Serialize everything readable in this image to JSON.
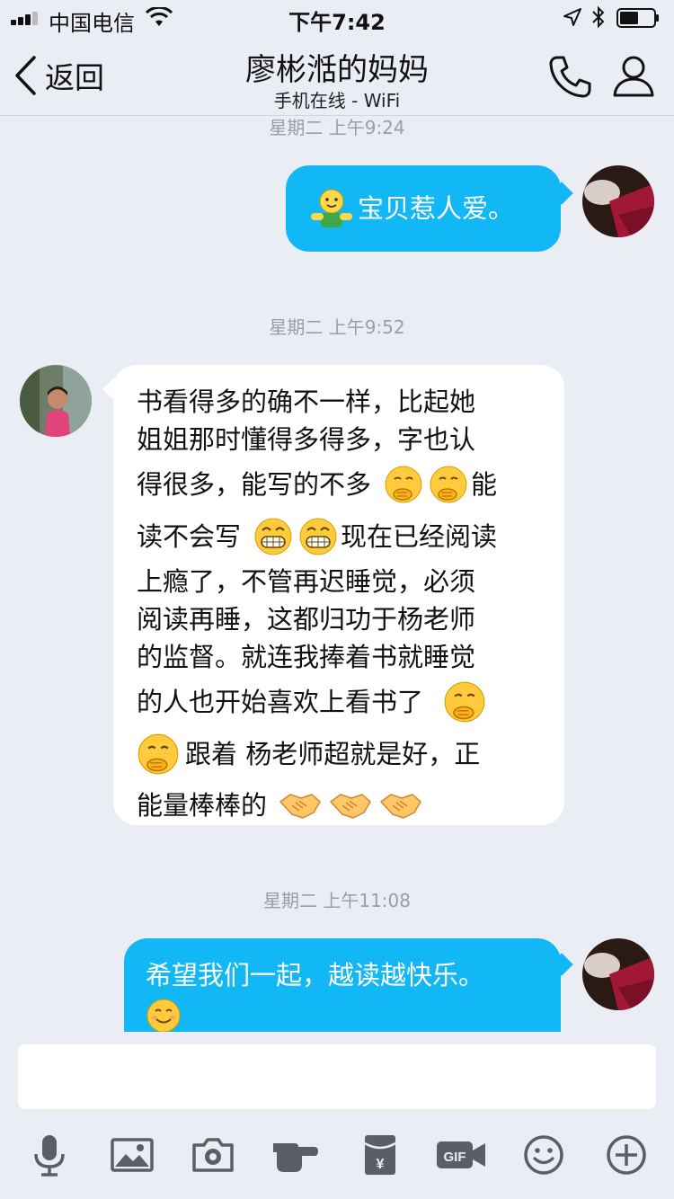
{
  "status_bar": {
    "carrier": "中国电信",
    "time": "下午7:42"
  },
  "nav": {
    "back_label": "返回",
    "title": "廖彬湉的妈妈",
    "subtitle": "手机在线 - WiFi"
  },
  "messages": [
    {
      "timestamp": "星期二 上午9:24",
      "direction": "outgoing",
      "text": "宝贝惹人爱。"
    },
    {
      "timestamp": "星期二 上午9:52",
      "direction": "incoming",
      "lines": [
        "书看得多的确不一样，比起她",
        "姐姐那时懂得多得多，字也认",
        "得很多，能写的不多",
        "能",
        "读不会写",
        "现在已经阅读",
        "上瘾了，不管再迟睡觉，必须",
        "阅读再睡，这都归功于杨老师",
        "的监督。就连我捧着书就睡觉",
        "的人也开始喜欢上看书了",
        "跟着 杨老师超就是好，正",
        "能量棒棒的"
      ]
    },
    {
      "timestamp": "星期二 上午11:08",
      "direction": "outgoing",
      "text": "希望我们一起，越读越快乐。"
    }
  ],
  "toolbar": {
    "icons": [
      "microphone-icon",
      "image-icon",
      "camera-icon",
      "poke-icon",
      "red-packet-icon",
      "gif-icon",
      "emoji-icon",
      "plus-icon"
    ],
    "red_packet_symbol": "¥",
    "gif_label": "GIF"
  },
  "colors": {
    "background": "#EBEDF5",
    "outgoing_bubble": "#12B7F5",
    "incoming_bubble": "#FFFFFF",
    "timestamp": "#9A9EA9",
    "icon": "#5B5E66"
  }
}
